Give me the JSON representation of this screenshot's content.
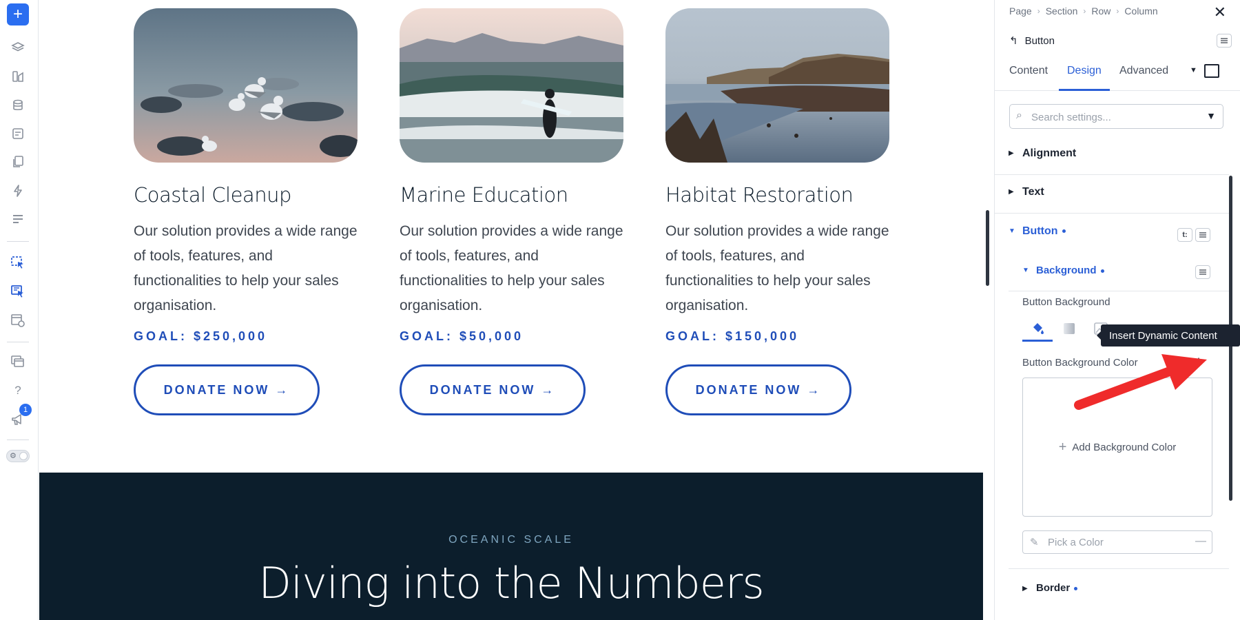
{
  "left_toolbar": {
    "add_label": "+",
    "icons": [
      "layers-icon",
      "theme-builder-icon",
      "database-icon",
      "form-icon",
      "pages-icon",
      "lightning-icon",
      "list-icon",
      "select-tool-icon",
      "select-multi-icon",
      "template-preview-icon",
      "windows-icon",
      "help-icon",
      "announcement-icon"
    ],
    "help_label": "?",
    "notification_count": "1"
  },
  "cards": [
    {
      "title": "Coastal Cleanup",
      "description": "Our solution provides a wide range of tools, features, and functionalities to help your sales organisation.",
      "goal": "GOAL: $250,000",
      "button": "DONATE NOW →"
    },
    {
      "title": "Marine Education",
      "description": "Our solution provides a wide range of tools, features, and functionalities to help your sales organisation.",
      "goal": "GOAL: $50,000",
      "button": "DONATE NOW →"
    },
    {
      "title": "Habitat Restoration",
      "description": "Our solution provides a wide range of tools, features, and functionalities to help your sales organisation.",
      "goal": "GOAL: $150,000",
      "button": "DONATE NOW →"
    }
  ],
  "section": {
    "eyebrow": "OCEANIC SCALE",
    "title": "Diving into the Numbers"
  },
  "panel": {
    "breadcrumb": [
      "Page",
      "Section",
      "Row",
      "Column"
    ],
    "breadcrumb_sep": "›",
    "close_label": "✕",
    "element_title": "Button",
    "back_label": "↰",
    "tabs": [
      "Content",
      "Design",
      "Advanced"
    ],
    "active_tab": "Design",
    "search_placeholder": "Search settings...",
    "groups": {
      "alignment": "Alignment",
      "text": "Text",
      "button": "Button",
      "background": "Background",
      "border": "Border"
    },
    "button_background_label": "Button Background",
    "button_background_color_label": "Button Background Color",
    "add_background_color": "Add Background Color",
    "pick_color_placeholder": "Pick a Color",
    "tooltip": "Insert Dynamic Content",
    "accent_color": "#2b5fd6"
  }
}
